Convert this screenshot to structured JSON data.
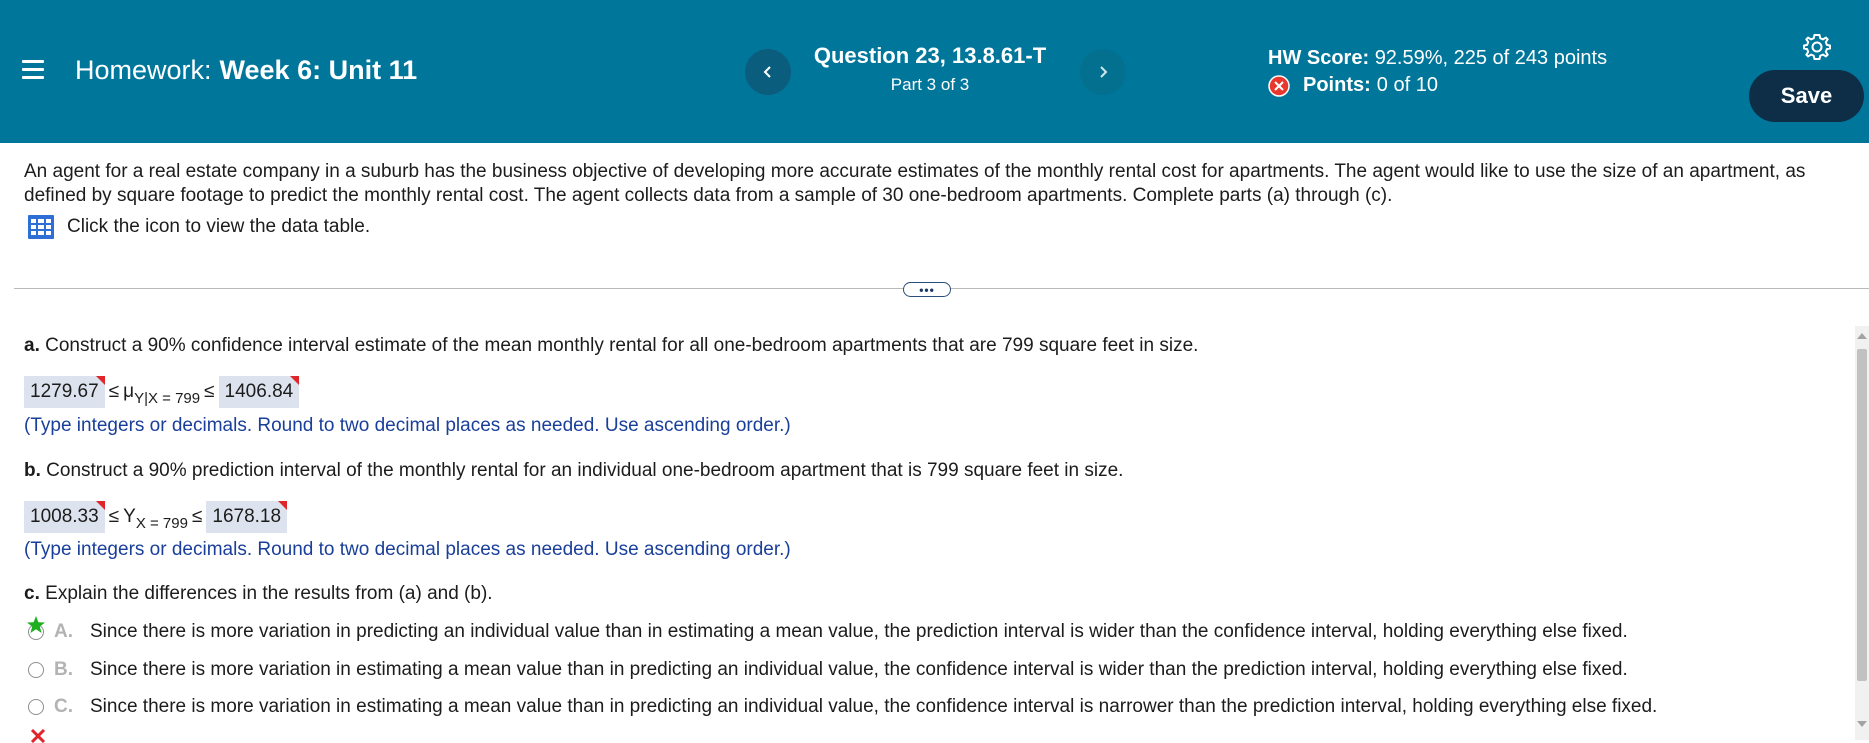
{
  "header": {
    "hw_label": "Homework:",
    "hw_name": "Week 6: Unit 11",
    "question_title": "Question 23, 13.8.61-T",
    "question_part": "Part 3 of 3",
    "score_label": "HW Score:",
    "score_value": "92.59%, 225 of 243 points",
    "points_label": "Points:",
    "points_value": "0 of 10",
    "save_label": "Save",
    "bg_color": "#00769b",
    "save_color": "#0e2e47",
    "icons": [
      "hamburger-menu-icon",
      "chevron-left-icon",
      "chevron-right-icon",
      "incorrect-x-icon",
      "gear-icon"
    ]
  },
  "problem": {
    "text": "An agent for a real estate company in a suburb has the business objective of developing more accurate estimates of the monthly rental cost for apartments. The agent would like to use the size of an apartment, as defined by square footage to predict the monthly rental cost. The agent collects data from a sample of 30 one-bedroom apartments. Complete parts (a) through (c).",
    "data_link": "Click the icon to view the data table.",
    "data_icon": "table-icon",
    "expand": "•••"
  },
  "part_a": {
    "label": "a.",
    "question": "Construct a 90% confidence interval estimate of the mean monthly rental for all one-bedroom apartments that are 799 square feet in size.",
    "lower": "1279.67",
    "leq1": "≤",
    "symbol": "μ",
    "subscript": "Y|X = 799",
    "leq2": "≤",
    "upper": "1406.84",
    "hint": "(Type integers or decimals. Round to two decimal places as needed. Use ascending order.)"
  },
  "part_b": {
    "label": "b.",
    "question": "Construct a 90% prediction interval of the monthly rental for an individual one-bedroom apartment that is 799 square feet in size.",
    "lower": "1008.33",
    "leq1": "≤",
    "symbol": "Y",
    "subscript": "X = 799",
    "leq2": "≤",
    "upper": "1678.18",
    "hint": "(Type integers or decimals. Round to two decimal places as needed. Use ascending order.)"
  },
  "part_c": {
    "label": "c.",
    "question": "Explain the differences in the results from (a) and (b).",
    "choices": [
      {
        "letter": "A.",
        "text": "Since there is more variation in predicting an individual value than in estimating a mean value, the prediction interval is wider than the confidence interval, holding everything else fixed."
      },
      {
        "letter": "B.",
        "text": "Since there is more variation in estimating a mean value than in predicting an individual value, the confidence interval is wider than the prediction interval, holding everything else fixed."
      },
      {
        "letter": "C.",
        "text": "Since there is more variation in estimating a mean value than in predicting an individual value, the confidence interval is narrower than the prediction interval, holding everything else fixed."
      }
    ],
    "correct_icon": "green-star-icon",
    "wrong_icon": "red-x-icon"
  }
}
